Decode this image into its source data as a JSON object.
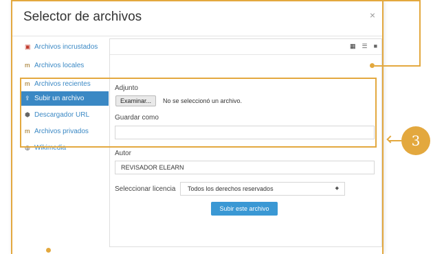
{
  "dialog": {
    "title": "Selector de archivos",
    "close_glyph": "×"
  },
  "sidebar": {
    "items": [
      {
        "label": "Archivos incrustados",
        "icon": "pdf-file-icon",
        "glyph": "▣"
      },
      {
        "label": "Archivos locales",
        "icon": "moodle-icon",
        "glyph": "m"
      },
      {
        "label": "Archivos recientes",
        "icon": "moodle-icon",
        "glyph": "m"
      },
      {
        "label": "Subir un archivo",
        "icon": "upload-icon",
        "glyph": "⇪"
      },
      {
        "label": "Descargador URL",
        "icon": "url-downloader-icon",
        "glyph": "⬢"
      },
      {
        "label": "Archivos privados",
        "icon": "moodle-icon",
        "glyph": "m"
      },
      {
        "label": "Wikimedia",
        "icon": "wikimedia-icon",
        "glyph": "◍"
      }
    ],
    "active_index": 3
  },
  "toolbar": {
    "views": [
      "grid-view-icon",
      "list-view-icon",
      "folder-view-icon"
    ],
    "glyphs": [
      "▦",
      "☰",
      "■"
    ]
  },
  "form": {
    "attachment_label": "Adjunto",
    "browse_button": "Examinar...",
    "no_file_text": "No se seleccionó un archivo.",
    "save_as_label": "Guardar como",
    "save_as_value": "",
    "author_label": "Autor",
    "author_value": "REVISADOR ELEARN",
    "license_label": "Seleccionar licencia",
    "license_value": "Todos los derechos reservados",
    "select_arrow": "◆",
    "upload_button": "Subir este archivo"
  },
  "annotation": {
    "number": "3",
    "color": "#e3a83e"
  },
  "colors": {
    "accent": "#3a88c4",
    "upload_button": "#3a98d4"
  }
}
